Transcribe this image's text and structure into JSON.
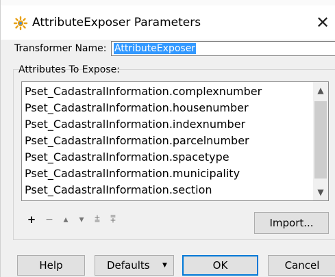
{
  "dialog": {
    "title": "AttributeExposer Parameters",
    "close_symbol": "✕"
  },
  "transformer_name": {
    "label": "Transformer Name:",
    "value": "AttributeExposer"
  },
  "attributes_to_expose": {
    "label": "Attributes To Expose:",
    "items": [
      "Pset_CadastralInformation.complexnumber",
      "Pset_CadastralInformation.housenumber",
      "Pset_CadastralInformation.indexnumber",
      "Pset_CadastralInformation.parcelnumber",
      "Pset_CadastralInformation.spacetype",
      "Pset_CadastralInformation.municipality",
      "Pset_CadastralInformation.section"
    ]
  },
  "toolbar": {
    "add": "+",
    "remove": "−",
    "move_up": "▴",
    "move_down": "▾",
    "move_top": "⩲",
    "move_bottom": "⩱"
  },
  "buttons": {
    "import": "Import...",
    "help": "Help",
    "defaults": "Defaults",
    "defaults_arrow": "▼",
    "ok": "OK",
    "cancel": "Cancel"
  },
  "icons": {
    "app": "attribute-exposer-icon",
    "scroll_up": "▲",
    "scroll_down": "▼"
  },
  "colors": {
    "selection": "#3399ff",
    "ok_border": "#0078d7"
  }
}
